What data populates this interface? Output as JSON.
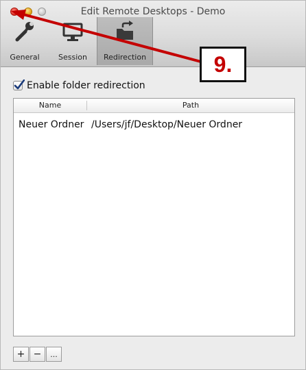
{
  "window": {
    "title": "Edit Remote Desktops - Demo"
  },
  "toolbar": {
    "items": [
      {
        "label": "General",
        "icon": "wrench-icon"
      },
      {
        "label": "Session",
        "icon": "monitor-icon"
      },
      {
        "label": "Redirection",
        "icon": "folder-export-icon",
        "selected": true
      }
    ]
  },
  "redirection": {
    "enable_label": "Enable folder redirection",
    "enabled": true,
    "columns": {
      "name": "Name",
      "path": "Path"
    },
    "rows": [
      {
        "name": "Neuer Ordner",
        "path": "/Users/jf/Desktop/Neuer Ordner"
      }
    ],
    "buttons": {
      "add": "+",
      "remove": "−",
      "more": "..."
    }
  },
  "annotation": {
    "label": "9.",
    "color": "#c40000"
  }
}
